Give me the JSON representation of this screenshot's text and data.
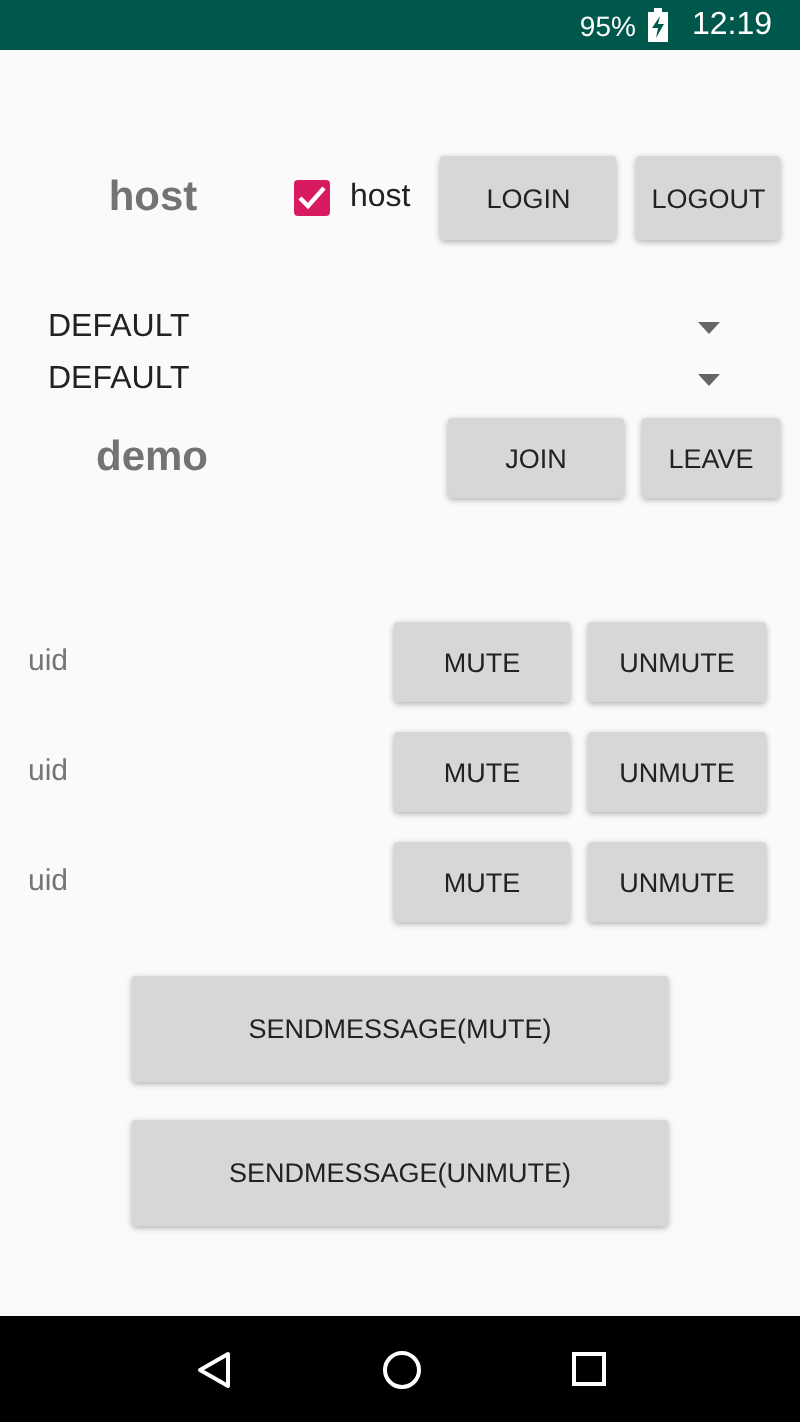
{
  "status_bar": {
    "battery": "95%",
    "time": "12:19"
  },
  "login_row": {
    "user": "host",
    "checkbox": {
      "label": "host",
      "checked": true
    },
    "buttons": [
      "LOGIN",
      "LOGOUT"
    ]
  },
  "spinners": [
    {
      "value": "DEFAULT"
    },
    {
      "value": "DEFAULT"
    }
  ],
  "channel_row": {
    "channel": "demo",
    "buttons": [
      "JOIN",
      "LEAVE"
    ]
  },
  "users": [
    {
      "uid": "uid",
      "buttons": [
        "MUTE",
        "UNMUTE"
      ]
    },
    {
      "uid": "uid",
      "buttons": [
        "MUTE",
        "UNMUTE"
      ]
    },
    {
      "uid": "uid",
      "buttons": [
        "MUTE",
        "UNMUTE"
      ]
    }
  ],
  "send_buttons": [
    "SENDMESSAGE(MUTE)",
    "SENDMESSAGE(UNMUTE)"
  ]
}
